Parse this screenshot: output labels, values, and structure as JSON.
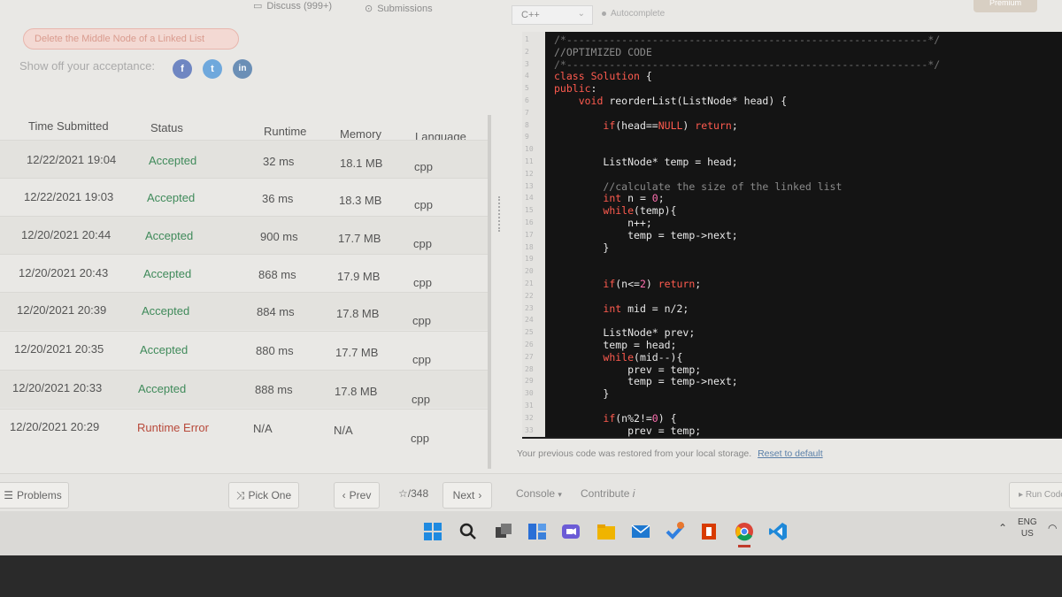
{
  "top_tabs": {
    "discuss": "Discuss (999+)",
    "submissions": "Submissions"
  },
  "editor_toolbar": {
    "language": "C++",
    "autocomplete": "Autocomplete",
    "premium": "Premium"
  },
  "problem_pill": "Delete the Middle Node of a Linked List",
  "share": {
    "label": "Show off your acceptance:",
    "facebook": "f",
    "twitter": "t",
    "linkedin": "in"
  },
  "table": {
    "headers": {
      "time": "Time Submitted",
      "status": "Status",
      "runtime": "Runtime",
      "memory": "Memory",
      "language": "Language"
    },
    "rows": [
      {
        "time": "12/22/2021 19:04",
        "status": "Accepted",
        "runtime": "32 ms",
        "memory": "18.1 MB",
        "language": "cpp"
      },
      {
        "time": "12/22/2021 19:03",
        "status": "Accepted",
        "runtime": "36 ms",
        "memory": "18.3 MB",
        "language": "cpp"
      },
      {
        "time": "12/20/2021 20:44",
        "status": "Accepted",
        "runtime": "900 ms",
        "memory": "17.7 MB",
        "language": "cpp"
      },
      {
        "time": "12/20/2021 20:43",
        "status": "Accepted",
        "runtime": "868 ms",
        "memory": "17.9 MB",
        "language": "cpp"
      },
      {
        "time": "12/20/2021 20:39",
        "status": "Accepted",
        "runtime": "884 ms",
        "memory": "17.8 MB",
        "language": "cpp"
      },
      {
        "time": "12/20/2021 20:35",
        "status": "Accepted",
        "runtime": "880 ms",
        "memory": "17.7 MB",
        "language": "cpp"
      },
      {
        "time": "12/20/2021 20:33",
        "status": "Accepted",
        "runtime": "888 ms",
        "memory": "17.8 MB",
        "language": "cpp"
      },
      {
        "time": "12/20/2021 20:29",
        "status": "Runtime Error",
        "runtime": "N/A",
        "memory": "N/A",
        "language": "cpp"
      }
    ]
  },
  "code": {
    "line_numbers": [
      "1",
      "2",
      "3",
      "4",
      "5",
      "6",
      "7",
      "8",
      "9",
      "10",
      "11",
      "12",
      "13",
      "14",
      "15",
      "16",
      "17",
      "18",
      "19",
      "20",
      "21",
      "22",
      "23",
      "24",
      "25",
      "26",
      "27",
      "28",
      "29",
      "30",
      "31",
      "32",
      "33"
    ],
    "lines": [
      "/*-----------------------------------------------------------*/",
      "//OPTIMIZED CODE",
      "/*-----------------------------------------------------------*/",
      "class Solution {",
      "public:",
      "    void reorderList(ListNode* head) {",
      "",
      "        if(head==NULL) return;",
      "",
      "",
      "        ListNode* temp = head;",
      "",
      "        //calculate the size of the linked list",
      "        int n = 0;",
      "        while(temp){",
      "            n++;",
      "            temp = temp->next;",
      "        }",
      "",
      "",
      "        if(n<=2) return;",
      "",
      "        int mid = n/2;",
      "",
      "        ListNode* prev;",
      "        temp = head;",
      "        while(mid--){",
      "            prev = temp;",
      "            temp = temp->next;",
      "        }",
      "",
      "        if(n%2!=0) {",
      "            prev = temp;"
    ]
  },
  "restored_msg": "Your previous code was restored from your local storage.",
  "reset_link": "Reset to default",
  "bottom_nav": {
    "problems": "Problems",
    "pick_one": "Pick One",
    "prev": "Prev",
    "page": "/348",
    "next": "Next",
    "console": "Console",
    "contribute": "Contribute",
    "run_code": "Run Code"
  },
  "tray": {
    "lang": "ENG",
    "region": "US"
  },
  "colors": {
    "accepted": "#3f8a5a",
    "runtime_error": "#b84a3b",
    "editor_bg": "#141414",
    "keyword": "#ff5b4f"
  }
}
